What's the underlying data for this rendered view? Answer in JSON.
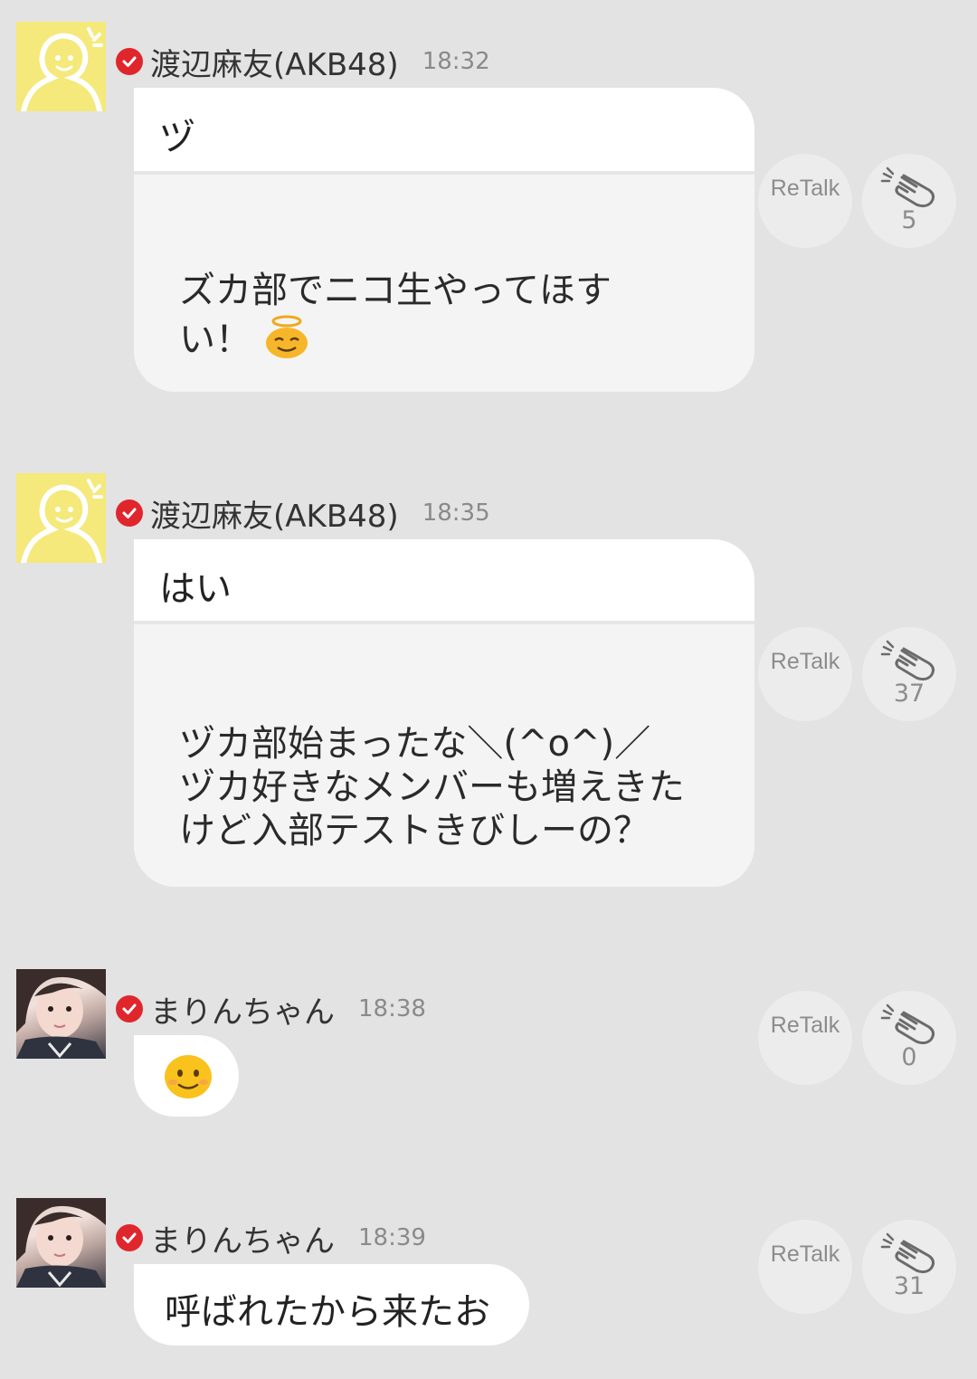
{
  "messages": [
    {
      "author": "渡辺麻友(AKB48)",
      "time": "18:32",
      "title": "ヅ",
      "quote_line1": "ズカ部でニコ生やってほす",
      "quote_line2": "い！",
      "quote_emoji": "halo-smile-emoji",
      "retalk": "ReTalk",
      "claps": "5"
    },
    {
      "author": "渡辺麻友(AKB48)",
      "time": "18:35",
      "title": "はい",
      "quote_line1": "ヅカ部始まったな＼(^o^)／",
      "quote_line2": "ヅカ好きなメンバーも増えきた",
      "quote_line3": "けど入部テストきびしーの？",
      "retalk": "ReTalk",
      "claps": "37"
    },
    {
      "author": "まりんちゃん",
      "time": "18:38",
      "emoji": "smiling-face-emoji",
      "retalk": "ReTalk",
      "claps": "0"
    },
    {
      "author": "まりんちゃん",
      "time": "18:39",
      "text": "呼ばれたから来たお",
      "retalk": "ReTalk",
      "claps": "31"
    }
  ],
  "colors": {
    "background": "#e3e3e3",
    "verified": "#e0262d",
    "avatar_yellow": "#f4e97a",
    "bubble": "#ffffff",
    "quote_bg": "#f4f4f4"
  }
}
